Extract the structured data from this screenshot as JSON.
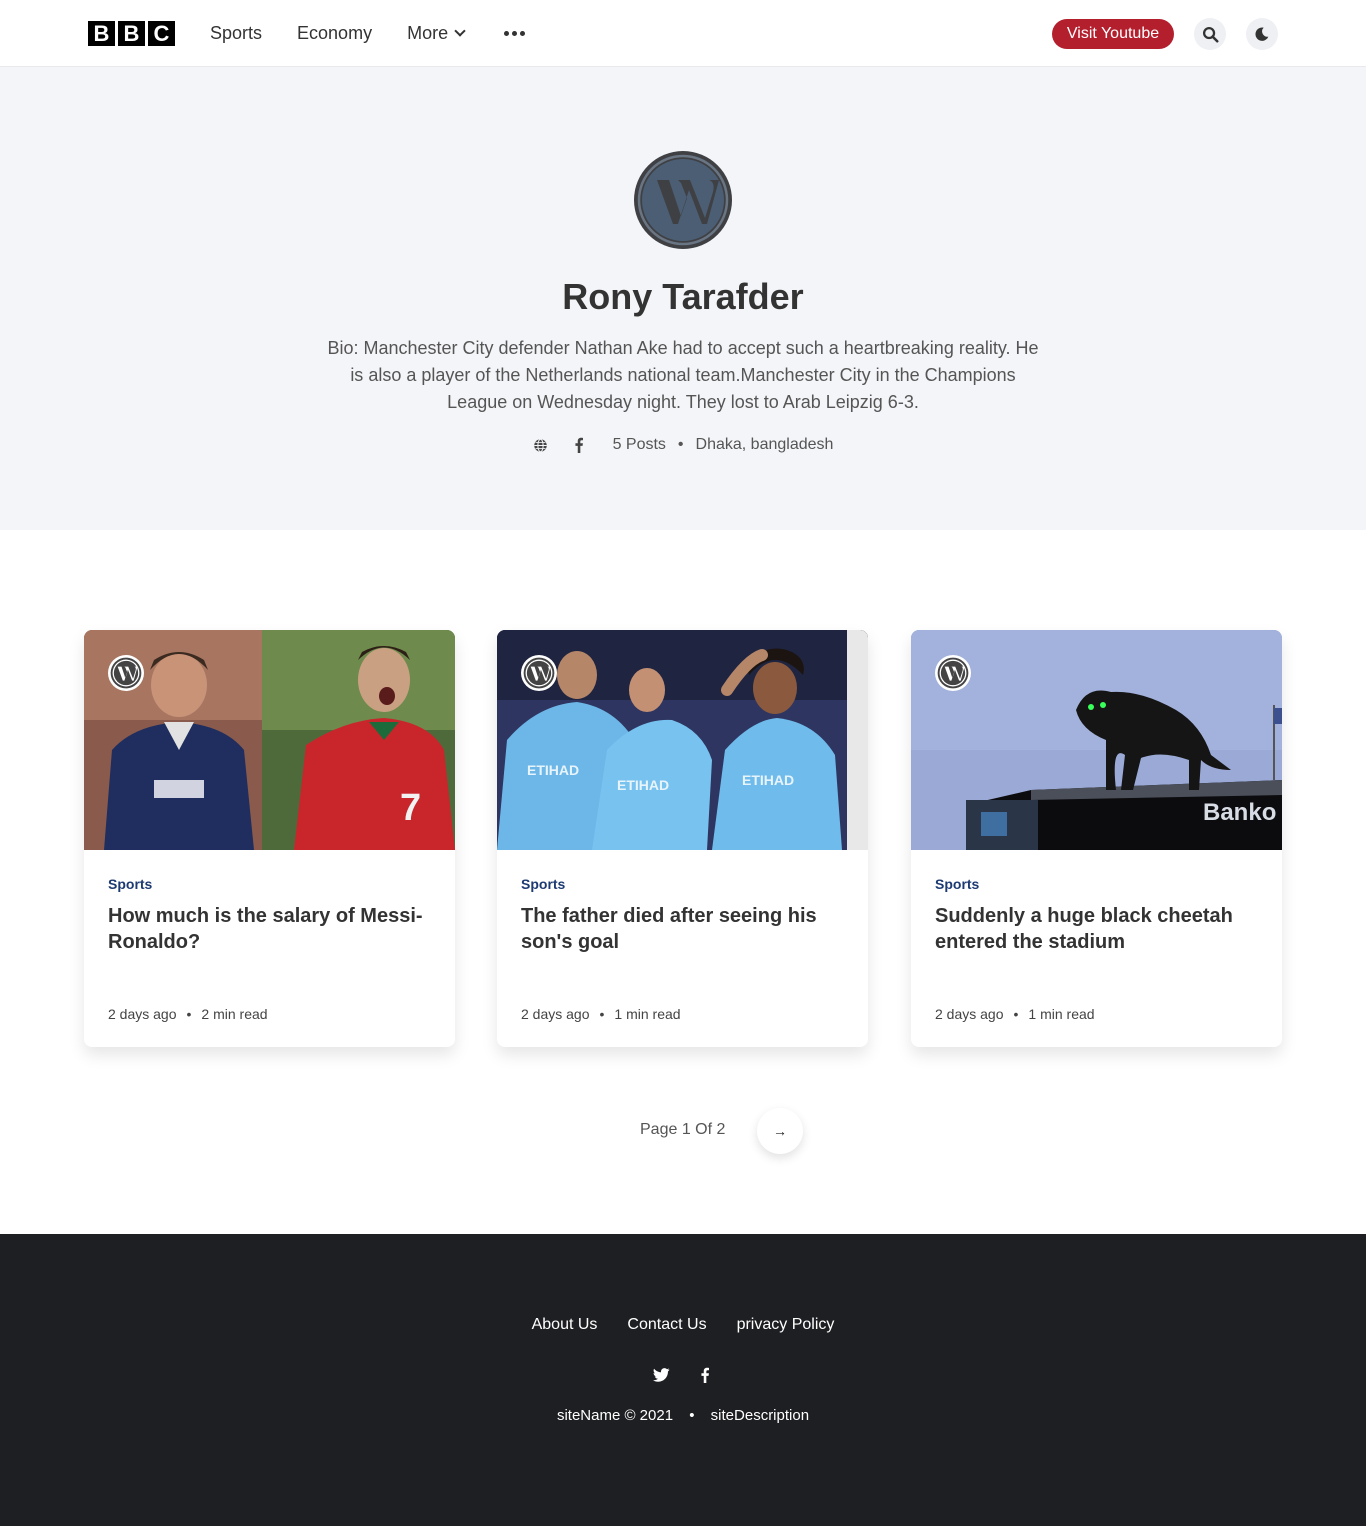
{
  "header": {
    "logo_letters": [
      "B",
      "B",
      "C"
    ],
    "nav": {
      "sports": "Sports",
      "economy": "Economy",
      "more": "More"
    },
    "youtube_button": "Visit Youtube",
    "icons": [
      "search-icon",
      "moon-icon",
      "more-dots-icon",
      "chevron-down-icon"
    ]
  },
  "author": {
    "name": "Rony Tarafder",
    "bio": "Bio: Manchester City defender Nathan Ake had to accept such a heartbreaking reality. He is also a player of the Netherlands national team.Manchester City in the Champions League on Wednesday night. They lost to Arab Leipzig 6-3.",
    "posts": "5 Posts",
    "location": "Dhaka, bangladesh",
    "separator": "•"
  },
  "posts": [
    {
      "category": "Sports",
      "title": "How much is the salary of Messi-Ronaldo?",
      "date": "2 days ago",
      "read_time": "2 min read"
    },
    {
      "category": "Sports",
      "title": "The father died after seeing his son's goal",
      "date": "2 days ago",
      "read_time": "1 min read"
    },
    {
      "category": "Sports",
      "title": "Suddenly a huge black cheetah entered the stadium",
      "date": "2 days ago",
      "read_time": "1 min read"
    }
  ],
  "pagination": {
    "label": "Page 1 Of 2",
    "next": "→"
  },
  "footer": {
    "links": {
      "about": "About Us",
      "contact": "Contact Us",
      "privacy": "privacy Policy"
    },
    "copyright": "siteName © 2021",
    "description": "siteDescription",
    "separator": "•"
  },
  "colors": {
    "accent_red": "#b41f2e",
    "category_blue": "#1d3b72",
    "hero_bg": "#f4f5f8",
    "footer_bg": "#1e1f22"
  }
}
